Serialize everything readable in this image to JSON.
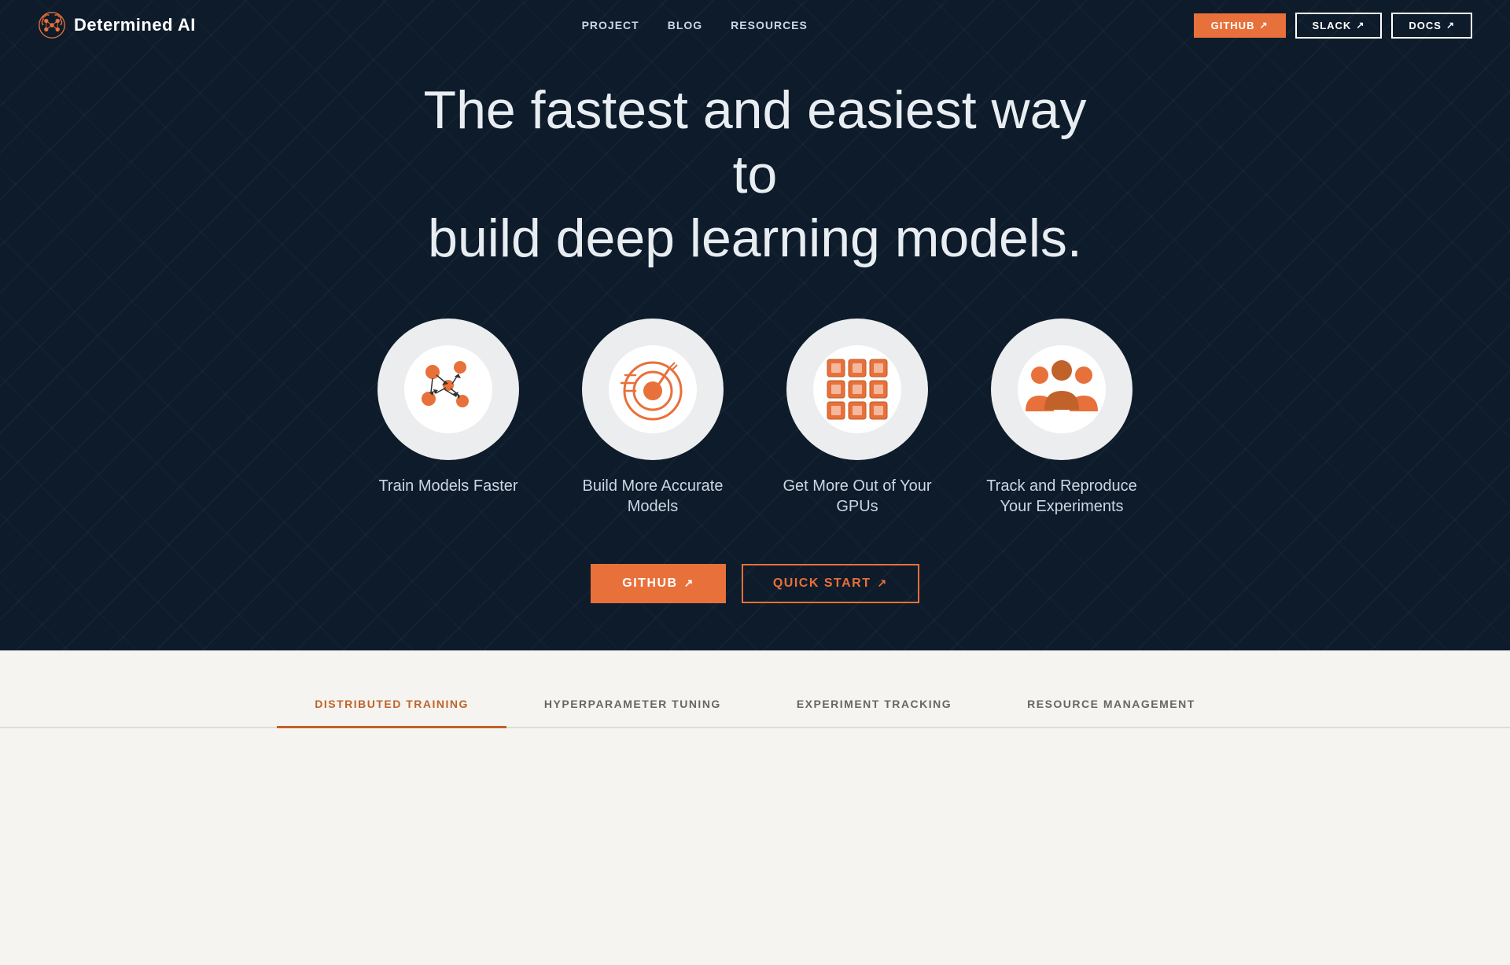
{
  "nav": {
    "logo_text": "Determined AI",
    "links": [
      {
        "label": "PROJECT",
        "id": "project"
      },
      {
        "label": "BLOG",
        "id": "blog"
      },
      {
        "label": "RESOURCES",
        "id": "resources"
      }
    ],
    "buttons": [
      {
        "label": "GITHUB",
        "id": "github-nav",
        "style": "filled"
      },
      {
        "label": "SLACK",
        "id": "slack-nav",
        "style": "outline"
      },
      {
        "label": "DOCS",
        "id": "docs-nav",
        "style": "outline"
      }
    ]
  },
  "hero": {
    "title_line1": "The fastest and easiest way to",
    "title_line2": "build deep learning models.",
    "cards": [
      {
        "label": "Train Models Faster",
        "icon": "scatter",
        "id": "train"
      },
      {
        "label": "Build More Accurate Models",
        "icon": "target",
        "id": "accurate"
      },
      {
        "label": "Get More Out of Your GPUs",
        "icon": "gpu",
        "id": "gpu"
      },
      {
        "label": "Track and Reproduce Your Experiments",
        "icon": "team",
        "id": "track"
      }
    ],
    "buttons": [
      {
        "label": "GITHUB",
        "id": "github-hero",
        "style": "filled"
      },
      {
        "label": "QUICK START",
        "id": "quickstart-hero",
        "style": "outline"
      }
    ]
  },
  "tabs": {
    "items": [
      {
        "label": "DISTRIBUTED TRAINING",
        "id": "distributed",
        "active": true
      },
      {
        "label": "HYPERPARAMETER TUNING",
        "id": "hyperparameter",
        "active": false
      },
      {
        "label": "EXPERIMENT TRACKING",
        "id": "experiment",
        "active": false
      },
      {
        "label": "RESOURCE MANAGEMENT",
        "id": "resource",
        "active": false
      }
    ]
  },
  "colors": {
    "orange": "#e8703a",
    "dark_bg": "#0d1b2a",
    "light_bg": "#f5f4f0"
  }
}
